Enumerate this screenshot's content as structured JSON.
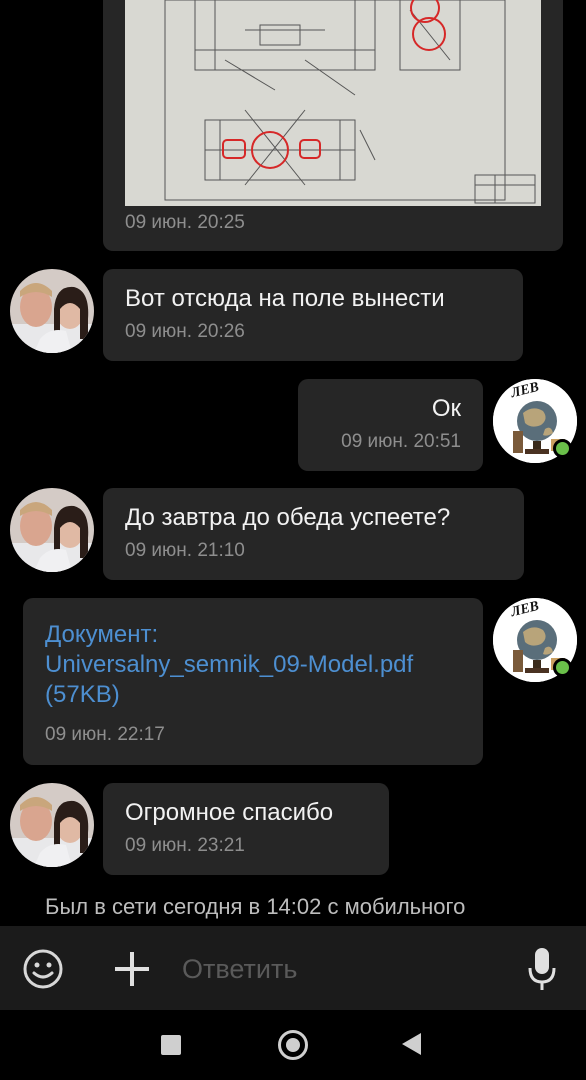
{
  "messages": [
    {
      "time": "09 июн. 20:25"
    },
    {
      "text": "Вот отсюда на поле вынести",
      "time": "09 июн. 20:26"
    },
    {
      "text": "Ок",
      "time": "09 июн. 20:51"
    },
    {
      "text": "До завтра до обеда успеете?",
      "time": "09 июн. 21:10"
    },
    {
      "doc_line1": "Документ:",
      "doc_line2": "Universalny_semnik_09-Model.pdf",
      "doc_line3": "(57KB)",
      "time": "09 июн. 22:17"
    },
    {
      "text": "Огромное спасибо",
      "time": "09 июн. 23:21"
    }
  ],
  "avatar_self_label": "ЛЕВ",
  "last_seen": "Был в сети сегодня в 14:02 с мобильного",
  "composer": {
    "placeholder": "Ответить"
  },
  "icons": {
    "emoji": "emoji-icon",
    "attach": "plus-icon",
    "mic": "microphone-icon",
    "nav_recent": "square-icon",
    "nav_home": "circle-icon",
    "nav_back": "back-triangle-icon"
  },
  "colors": {
    "bubble": "#262626",
    "link": "#4d8fd1",
    "online": "#6ac04a",
    "time": "#8e8e8e"
  }
}
